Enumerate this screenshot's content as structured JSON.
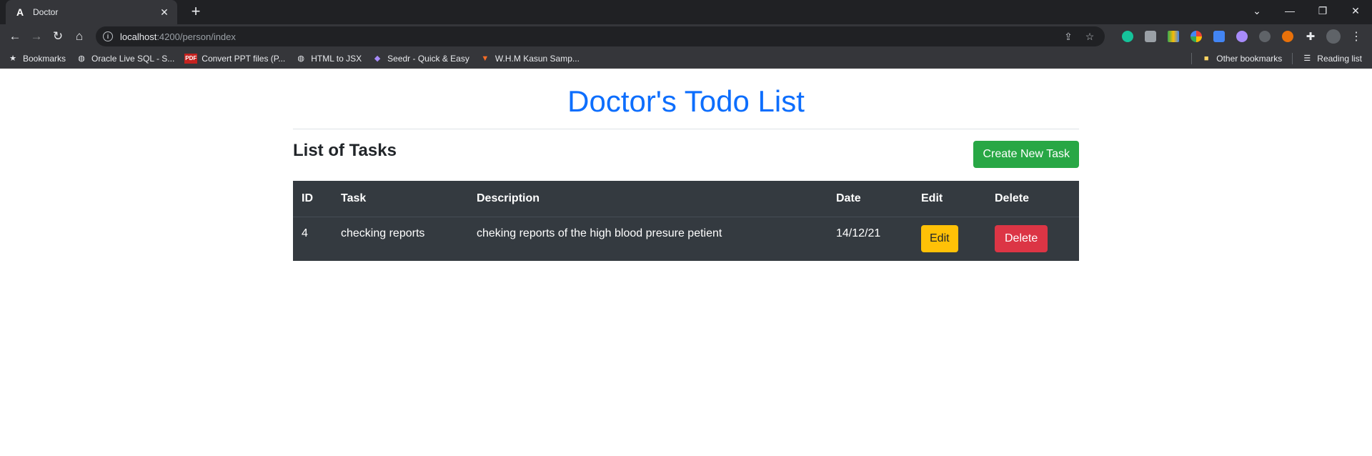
{
  "browser": {
    "tab_title": "Doctor",
    "tab_favicon": "A",
    "url_host": "localhost",
    "url_path": ":4200/person/index",
    "bookmarks": [
      {
        "label": "Bookmarks",
        "icon": "star-icon"
      },
      {
        "label": "Oracle Live SQL - S...",
        "icon": "globe-icon"
      },
      {
        "label": "Convert PPT files (P...",
        "icon": "pdf-icon"
      },
      {
        "label": "HTML to JSX",
        "icon": "globe-icon"
      },
      {
        "label": "Seedr - Quick & Easy",
        "icon": "seedr-icon"
      },
      {
        "label": "W.H.M Kasun Samp...",
        "icon": "gitlab-icon"
      }
    ],
    "other_bookmarks": "Other bookmarks",
    "reading_list": "Reading list"
  },
  "page": {
    "heading": "Doctor's Todo List",
    "section_title": "List of Tasks",
    "create_button": "Create New Task",
    "columns": {
      "id": "ID",
      "task": "Task",
      "description": "Description",
      "date": "Date",
      "edit": "Edit",
      "delete": "Delete"
    },
    "rows": [
      {
        "id": "4",
        "task": "checking reports",
        "description": "cheking reports of the high blood presure petient",
        "date": "14/12/21",
        "edit_label": "Edit",
        "delete_label": "Delete"
      }
    ]
  },
  "colors": {
    "heading": "#0d6efd",
    "success": "#28a745",
    "warning": "#ffc107",
    "danger": "#dc3545",
    "table_bg": "#343a40"
  }
}
